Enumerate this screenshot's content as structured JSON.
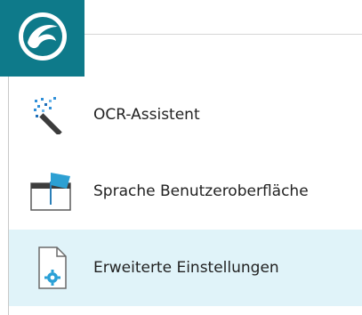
{
  "app": {
    "logo_icon": "app-logo-icon",
    "accent_color": "#0e7a8a"
  },
  "menu": {
    "items": [
      {
        "label": "OCR-Assistent",
        "icon": "magic-wand-icon",
        "highlighted": false
      },
      {
        "label": "Sprache Benutzeroberfläche",
        "icon": "language-flag-icon",
        "highlighted": false
      },
      {
        "label": "Erweiterte Einstellungen",
        "icon": "settings-document-icon",
        "highlighted": true
      }
    ],
    "highlight_color": "#e0f3f9"
  }
}
